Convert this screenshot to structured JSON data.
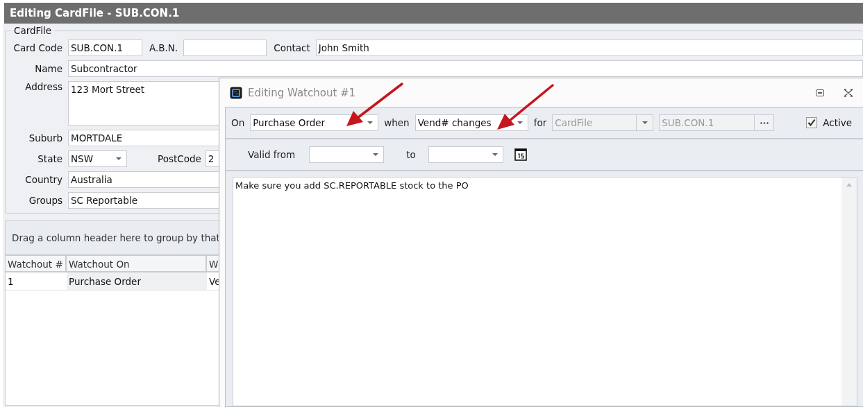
{
  "window": {
    "title": "Editing CardFile - SUB.CON.1"
  },
  "cardfile": {
    "legend": "CardFile",
    "card_code": {
      "label": "Card Code",
      "value": "SUB.CON.1"
    },
    "abn": {
      "label": "A.B.N."
    },
    "contact": {
      "label": "Contact",
      "value": "John Smith"
    },
    "name": {
      "label": "Name",
      "value": "Subcontractor"
    },
    "address": {
      "label": "Address",
      "value": "123 Mort Street"
    },
    "suburb": {
      "label": "Suburb",
      "value": "MORTDALE"
    },
    "state": {
      "label": "State",
      "value": "NSW"
    },
    "postcode": {
      "label": "PostCode",
      "value": "2"
    },
    "country": {
      "label": "Country",
      "value": "Australia"
    },
    "groups": {
      "label": "Groups",
      "value": "SC Reportable"
    }
  },
  "grid": {
    "group_hint": "Drag a column header here to group by that",
    "columns": [
      "Watchout #",
      "Watchout On",
      "W"
    ],
    "rows": [
      {
        "cells": [
          "1",
          "Purchase Order",
          "Ve"
        ]
      }
    ]
  },
  "dialog": {
    "title": "Editing Watchout #1",
    "on": {
      "label": "On",
      "value": "Purchase Order",
      "disabled": false
    },
    "when": {
      "label": "when",
      "value": "Vend# changes",
      "disabled": false
    },
    "for": {
      "label": "for",
      "value": "CardFile",
      "disabled": true
    },
    "card": {
      "value": "SUB.CON.1",
      "disabled": true
    },
    "active": {
      "label": "Active",
      "checked": true
    },
    "valid_from": {
      "label": "Valid from"
    },
    "to": {
      "label": "to"
    },
    "memo": "Make sure you add SC.REPORTABLE stock to the PO"
  }
}
